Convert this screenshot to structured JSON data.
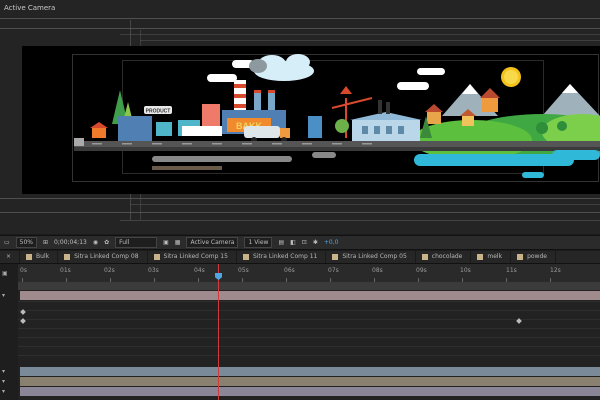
{
  "viewer": {
    "label": "Active Camera"
  },
  "status_bar": {
    "zoom": "50%",
    "timecode": "0;00;04;13",
    "resolution": "Full",
    "camera": "Active Camera",
    "view": "1 View",
    "exposure": "+0,0"
  },
  "tabs": [
    {
      "label": "Bulk"
    },
    {
      "label": "Sitra Linked Comp 08"
    },
    {
      "label": "Sitra Linked Comp 15"
    },
    {
      "label": "Sitra Linked Comp 11"
    },
    {
      "label": "Sitra Linked Comp 05"
    },
    {
      "label": "chocolade"
    },
    {
      "label": "melk"
    },
    {
      "label": "powde"
    }
  ],
  "ruler": {
    "ticks": [
      "0s",
      "01s",
      "02s",
      "03s",
      "04s",
      "05s",
      "06s",
      "07s",
      "08s",
      "09s",
      "10s",
      "11s",
      "12s"
    ]
  },
  "art": {
    "sign_text": "PRODUCT",
    "tank_text": "BAKK"
  },
  "colors": {
    "playhead": "#d23b3b",
    "accent": "#4fa6e0"
  }
}
